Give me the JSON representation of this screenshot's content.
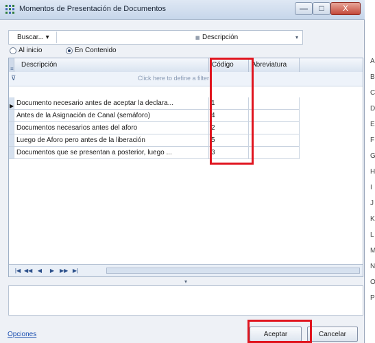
{
  "window": {
    "title": "Momentos de Presentación de Documentos",
    "controls": {
      "minimize": "—",
      "maximize": "□",
      "close": "X"
    }
  },
  "search": {
    "buscar_label": "Buscar... ▾",
    "input_value": "",
    "field_label": "Descripción",
    "dropdown_arrow": "▾"
  },
  "search_mode": {
    "options": [
      {
        "label": "Al inicio",
        "checked": false
      },
      {
        "label": "En Contenido",
        "checked": true
      }
    ]
  },
  "grid": {
    "columns": [
      "Descripción",
      "Código",
      "Abreviatura"
    ],
    "filter_hint": "Click here to define a filter",
    "rows": [
      {
        "descripcion": "Documento necesario antes de aceptar la declara...",
        "codigo": "1",
        "abreviatura": "",
        "current": true
      },
      {
        "descripcion": "Antes de la Asignación de Canal (semáforo)",
        "codigo": "4",
        "abreviatura": "",
        "current": false
      },
      {
        "descripcion": "Documentos necesarios antes del aforo",
        "codigo": "2",
        "abreviatura": "",
        "current": false
      },
      {
        "descripcion": "Luego de Aforo pero antes de la liberación",
        "codigo": "5",
        "abreviatura": "",
        "current": false
      },
      {
        "descripcion": "Documentos que se presentan a posterior, luego ...",
        "codigo": "3",
        "abreviatura": "",
        "current": false
      }
    ],
    "nav_buttons": [
      "|◀",
      "◀◀",
      "◀",
      "▶",
      "▶▶",
      "▶|"
    ]
  },
  "footer": {
    "options_link": "Opciones",
    "accept_label": "Aceptar",
    "cancel_label": "Cancelar"
  },
  "side_letters": [
    "A",
    "B",
    "C",
    "D",
    "E",
    "F",
    "G",
    "H",
    "I",
    "J",
    "K",
    "L",
    "M",
    "N",
    "O",
    "P"
  ],
  "highlight_color": "#e0141e"
}
